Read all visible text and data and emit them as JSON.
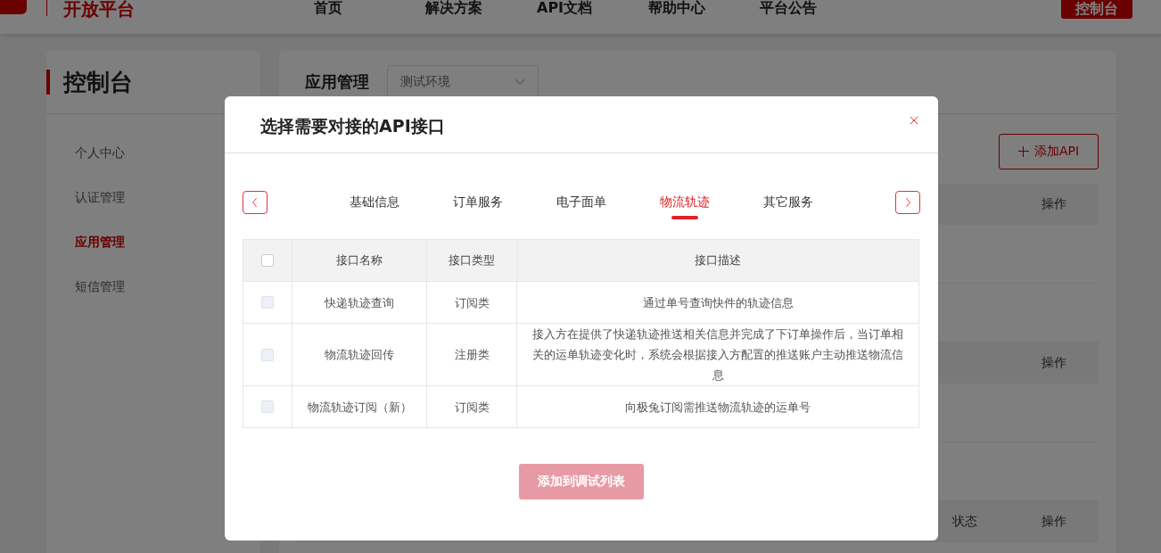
{
  "header": {
    "logo_text": "开放平台",
    "nav": [
      {
        "label": "首页"
      },
      {
        "label": "解决方案"
      },
      {
        "label": "API文档"
      },
      {
        "label": "帮助中心"
      },
      {
        "label": "平台公告"
      }
    ],
    "console_button": "控制台"
  },
  "sidebar": {
    "title": "控制台",
    "items": [
      {
        "label": "个人中心",
        "selected": false
      },
      {
        "label": "认证管理",
        "selected": false
      },
      {
        "label": "应用管理",
        "selected": true
      },
      {
        "label": "短信管理",
        "selected": false
      }
    ]
  },
  "main": {
    "title": "应用管理",
    "env_select": {
      "value": "测试环境"
    },
    "add_button": "添加API",
    "tables": [
      {
        "columns": [
          "操作"
        ]
      },
      {
        "columns": [
          "操作"
        ]
      },
      {
        "columns": [
          "状态",
          "操作"
        ]
      }
    ]
  },
  "dialog": {
    "title": "选择需要对接的API接口",
    "tabs": [
      {
        "label": "基础信息",
        "selected": false
      },
      {
        "label": "订单服务",
        "selected": false
      },
      {
        "label": "电子面单",
        "selected": false
      },
      {
        "label": "物流轨迹",
        "selected": true
      },
      {
        "label": "其它服务",
        "selected": false
      }
    ],
    "table": {
      "select_all": {
        "checked": false,
        "disabled": false
      },
      "columns": [
        "接口名称",
        "接口类型",
        "接口描述"
      ],
      "rows": [
        {
          "checked": false,
          "disabled": true,
          "name": "快递轨迹查询",
          "type": "订阅类",
          "description": "通过单号查询快件的轨迹信息"
        },
        {
          "checked": false,
          "disabled": true,
          "name": "物流轨迹回传",
          "type": "注册类",
          "description": "接入方在提供了快递轨迹推送相关信息并完成了下订单操作后，当订单相关的运单轨迹变化时，系统会根据接入方配置的推送账户主动推送物流信息"
        },
        {
          "checked": false,
          "disabled": true,
          "name": "物流轨迹订阅（新）",
          "type": "订阅类",
          "description": "向极兔订阅需推送物流轨迹的运单号"
        }
      ]
    },
    "submit_button": {
      "label": "添加到调试列表",
      "disabled": true
    }
  }
}
